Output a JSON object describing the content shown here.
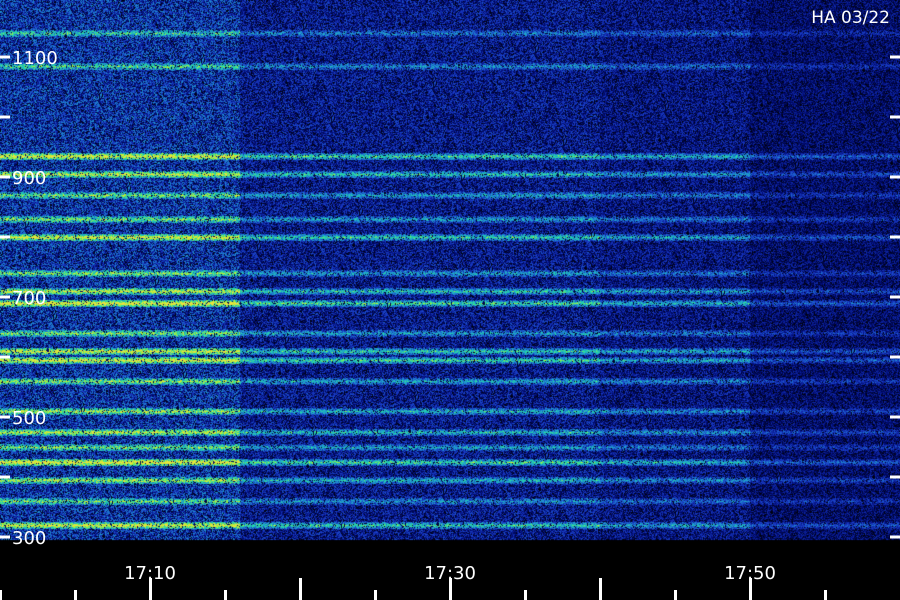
{
  "chart_data": {
    "type": "heatmap",
    "title": "",
    "corner_label": "HA 03/22",
    "xlabel": "",
    "ylabel": "",
    "x_ticks": [
      {
        "value": "17:10",
        "labeled": true
      },
      {
        "value": "17:30",
        "labeled": true
      },
      {
        "value": "17:50",
        "labeled": true
      }
    ],
    "x_range_minutes": [
      "17:00",
      "17:59"
    ],
    "y_range": [
      300,
      1150
    ],
    "y_ticks": [
      300,
      400,
      500,
      600,
      700,
      800,
      900,
      1000,
      1100
    ],
    "y_tick_labels": [
      {
        "value": 300,
        "text": "300"
      },
      {
        "value": 500,
        "text": "500"
      },
      {
        "value": 700,
        "text": "700"
      },
      {
        "value": 900,
        "text": "900"
      },
      {
        "value": 1100,
        "text": "1100"
      }
    ],
    "colormap": [
      "#000000",
      "#000a70",
      "#1a3cc8",
      "#1f9fd0",
      "#25e0a0",
      "#b8f030",
      "#f0e040"
    ],
    "bands": [
      {
        "y": 320,
        "intensity": 0.85
      },
      {
        "y": 360,
        "intensity": 0.55
      },
      {
        "y": 395,
        "intensity": 0.7
      },
      {
        "y": 425,
        "intensity": 0.95
      },
      {
        "y": 450,
        "intensity": 0.6
      },
      {
        "y": 475,
        "intensity": 0.75
      },
      {
        "y": 510,
        "intensity": 0.7
      },
      {
        "y": 560,
        "intensity": 0.65
      },
      {
        "y": 595,
        "intensity": 0.9
      },
      {
        "y": 610,
        "intensity": 0.85
      },
      {
        "y": 640,
        "intensity": 0.6
      },
      {
        "y": 690,
        "intensity": 0.95
      },
      {
        "y": 710,
        "intensity": 0.8
      },
      {
        "y": 740,
        "intensity": 0.6
      },
      {
        "y": 800,
        "intensity": 0.85
      },
      {
        "y": 830,
        "intensity": 0.6
      },
      {
        "y": 870,
        "intensity": 0.6
      },
      {
        "y": 905,
        "intensity": 0.8
      },
      {
        "y": 935,
        "intensity": 0.9
      },
      {
        "y": 1085,
        "intensity": 0.5
      },
      {
        "y": 1140,
        "intensity": 0.45
      }
    ],
    "segments": [
      {
        "from": "17:00",
        "to": "17:16",
        "level": 1.0
      },
      {
        "from": "17:16",
        "to": "17:40",
        "level": 0.62
      },
      {
        "from": "17:40",
        "to": "17:50",
        "level": 0.5
      },
      {
        "from": "17:50",
        "to": "17:59",
        "level": 0.3
      }
    ],
    "background_level": 0.35,
    "grid": false
  }
}
